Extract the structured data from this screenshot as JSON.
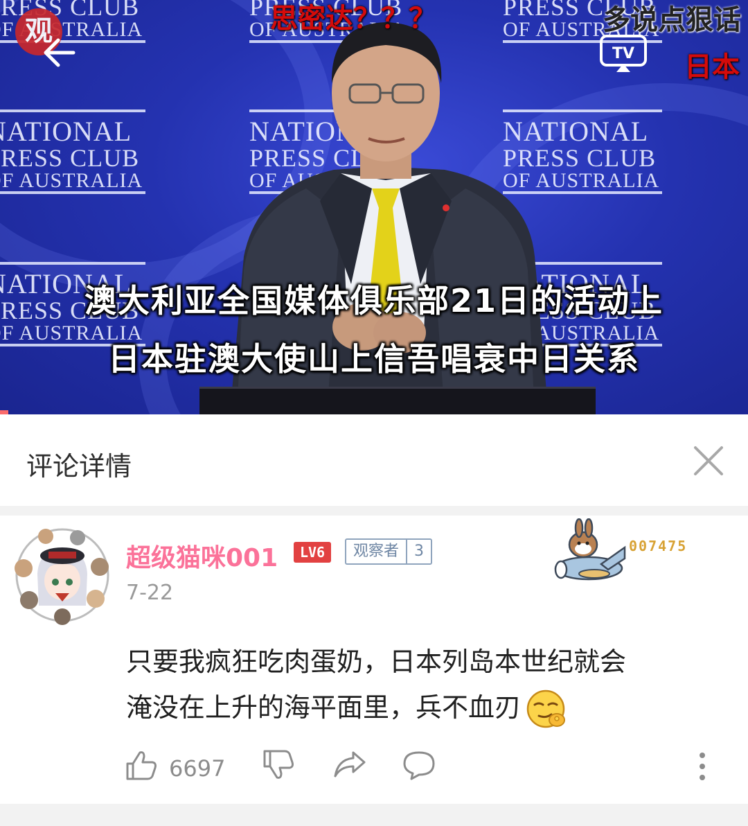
{
  "video": {
    "backdrop": {
      "line1": "NATIONAL",
      "line2": "PRESS CLUB",
      "line3": "OF AUSTRALIA"
    },
    "subtitle_line1": "澳大利亚全国媒体俱乐部21日的活动上",
    "subtitle_line2": "日本驻澳大使山上信吾唱衰中日关系",
    "danmaku": [
      {
        "text": "思密达？？？",
        "color": "#d40b0b"
      },
      {
        "text": "多说点狠话",
        "color": "#222222"
      },
      {
        "text": "日本",
        "color": "#d40b0b"
      }
    ],
    "logo_text": "观",
    "tv_label": "TV"
  },
  "panel": {
    "title": "评论详情"
  },
  "comment": {
    "username": "超级猫咪001",
    "level": "LV6",
    "medal_name": "观察者",
    "medal_level": "3",
    "date": "7-22",
    "fan_number": "007475",
    "text_line1": "只要我疯狂吃肉蛋奶，日本列岛本世纪就会",
    "text_line2": "淹没在上升的海平面里，兵不血刃",
    "like_count": "6697"
  },
  "icons": {
    "back": "back-arrow-icon",
    "cast": "tv-cast-icon",
    "close": "close-icon",
    "like": "thumbs-up-icon",
    "dislike": "thumbs-down-icon",
    "share": "share-icon",
    "reply": "reply-icon",
    "more": "more-vertical-icon"
  },
  "colors": {
    "username": "#fb7299",
    "level_badge": "#e24141",
    "medal_border": "#8fa4bd",
    "fan_number": "#d8a234",
    "video_bg": "#2432b0"
  }
}
